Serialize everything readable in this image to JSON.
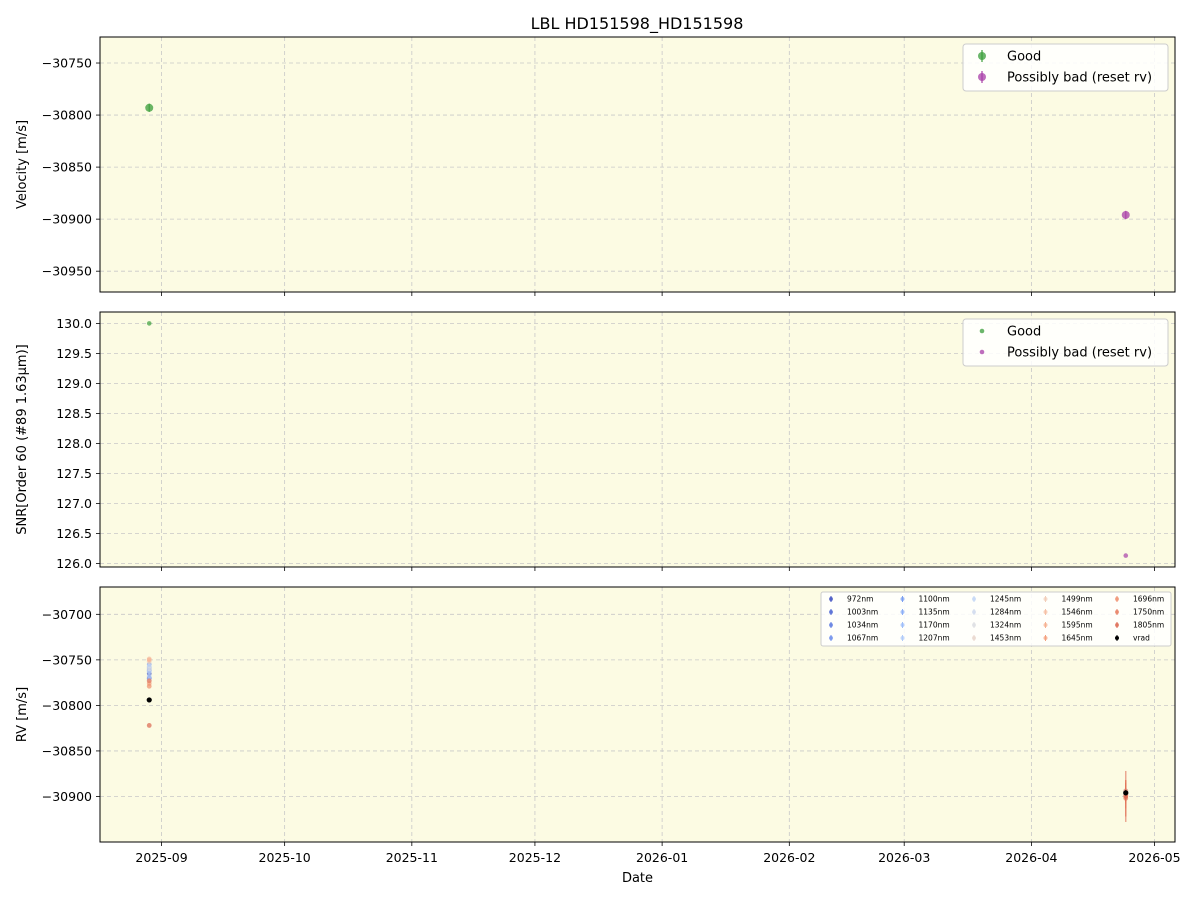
{
  "title": "LBL HD151598_HD151598",
  "colors": {
    "plot_bg": "#fcfbe3",
    "good": "#3a9e3a",
    "bad": "#a83ea8",
    "grid": "#c8c8c8",
    "vrad": "#000000"
  },
  "chart_data": [
    {
      "type": "scatter",
      "ylabel": "Velocity [m/s]",
      "xlabel": "",
      "ylim": [
        -30970,
        -30725
      ],
      "yticks": [
        -30750,
        -30800,
        -30850,
        -30900,
        -30950
      ],
      "grid": true,
      "legend_position": "top-right",
      "series": [
        {
          "name": "Good",
          "color": "#3a9e3a",
          "points": [
            {
              "x": "2025-08-29",
              "y": -30793,
              "err": 4
            }
          ]
        },
        {
          "name": "Possibly bad (reset rv)",
          "color": "#a83ea8",
          "points": [
            {
              "x": "2026-04-24",
              "y": -30896,
              "err": 4
            }
          ]
        }
      ]
    },
    {
      "type": "scatter",
      "ylabel": "SNR[Order 60 (#89 1.63μm)]",
      "xlabel": "",
      "ylim": [
        125.94,
        130.19
      ],
      "yticks": [
        126.0,
        126.5,
        127.0,
        127.5,
        128.0,
        128.5,
        129.0,
        129.5,
        130.0
      ],
      "grid": true,
      "legend_position": "top-right",
      "series": [
        {
          "name": "Good",
          "color": "#3a9e3a",
          "points": [
            {
              "x": "2025-08-29",
              "y": 130.0
            }
          ]
        },
        {
          "name": "Possibly bad (reset rv)",
          "color": "#a83ea8",
          "points": [
            {
              "x": "2026-04-24",
              "y": 126.13
            }
          ]
        }
      ]
    },
    {
      "type": "scatter",
      "ylabel": "RV [m/s]",
      "xlabel": "Date",
      "ylim": [
        -30950,
        -30670
      ],
      "yticks": [
        -30700,
        -30750,
        -30800,
        -30850,
        -30900
      ],
      "grid": true,
      "legend_position": "top-right",
      "series": [
        {
          "name": "972nm",
          "color": "#3b4cc0",
          "points": [
            {
              "x": "2025-08-29",
              "y": -30765
            },
            {
              "x": "2026-04-24",
              "y": -30896,
              "err": 8
            }
          ]
        },
        {
          "name": "1003nm",
          "color": "#4a63d3",
          "points": [
            {
              "x": "2025-08-29",
              "y": -30770
            },
            {
              "x": "2026-04-24",
              "y": -30897,
              "err": 8
            }
          ]
        },
        {
          "name": "1034nm",
          "color": "#5a78e0",
          "points": [
            {
              "x": "2025-08-29",
              "y": -30760
            },
            {
              "x": "2026-04-24",
              "y": -30895,
              "err": 8
            }
          ]
        },
        {
          "name": "1067nm",
          "color": "#6a8bec",
          "points": [
            {
              "x": "2025-08-29",
              "y": -30762
            },
            {
              "x": "2026-04-24",
              "y": -30898,
              "err": 8
            }
          ]
        },
        {
          "name": "1100nm",
          "color": "#7b9ff2",
          "points": [
            {
              "x": "2025-08-29",
              "y": -30755
            },
            {
              "x": "2026-04-24",
              "y": -30894,
              "err": 8
            }
          ]
        },
        {
          "name": "1135nm",
          "color": "#8caff7",
          "points": [
            {
              "x": "2025-08-29",
              "y": -30758
            },
            {
              "x": "2026-04-24",
              "y": -30896,
              "err": 8
            }
          ]
        },
        {
          "name": "1170nm",
          "color": "#9ebef9",
          "points": [
            {
              "x": "2025-08-29",
              "y": -30772
            },
            {
              "x": "2026-04-24",
              "y": -30895,
              "err": 8
            }
          ]
        },
        {
          "name": "1207nm",
          "color": "#b0cbf9",
          "points": [
            {
              "x": "2025-08-29",
              "y": -30768
            },
            {
              "x": "2026-04-24",
              "y": -30897,
              "err": 8
            }
          ]
        },
        {
          "name": "1245nm",
          "color": "#c0d4f5",
          "points": [
            {
              "x": "2025-08-29",
              "y": -30763
            },
            {
              "x": "2026-04-24",
              "y": -30896,
              "err": 8
            }
          ]
        },
        {
          "name": "1284nm",
          "color": "#cfdaee",
          "points": [
            {
              "x": "2025-08-29",
              "y": -30757
            },
            {
              "x": "2026-04-24",
              "y": -30895,
              "err": 8
            }
          ]
        },
        {
          "name": "1324nm",
          "color": "#dcdde2",
          "points": [
            {
              "x": "2025-08-29",
              "y": -30760
            },
            {
              "x": "2026-04-24",
              "y": -30897,
              "err": 8
            }
          ]
        },
        {
          "name": "1453nm",
          "color": "#e8d6cc",
          "points": [
            {
              "x": "2025-08-29",
              "y": -30774
            },
            {
              "x": "2026-04-24",
              "y": -30896,
              "err": 10
            }
          ]
        },
        {
          "name": "1499nm",
          "color": "#f1cdb9",
          "points": [
            {
              "x": "2025-08-29",
              "y": -30752
            },
            {
              "x": "2026-04-24",
              "y": -30895,
              "err": 10
            }
          ]
        },
        {
          "name": "1546nm",
          "color": "#f5c0a5",
          "points": [
            {
              "x": "2025-08-29",
              "y": -30749
            },
            {
              "x": "2026-04-24",
              "y": -30898,
              "err": 10
            }
          ]
        },
        {
          "name": "1595nm",
          "color": "#f6b191",
          "points": [
            {
              "x": "2025-08-29",
              "y": -30750
            },
            {
              "x": "2026-04-24",
              "y": -30896,
              "err": 10
            }
          ]
        },
        {
          "name": "1645nm",
          "color": "#f4a07e",
          "points": [
            {
              "x": "2025-08-29",
              "y": -30776
            },
            {
              "x": "2026-04-24",
              "y": -30894,
              "err": 12
            }
          ]
        },
        {
          "name": "1696nm",
          "color": "#ef8e6c",
          "points": [
            {
              "x": "2025-08-29",
              "y": -30779
            },
            {
              "x": "2026-04-24",
              "y": -30899,
              "err": 14
            }
          ]
        },
        {
          "name": "1750nm",
          "color": "#e77a5c",
          "points": [
            {
              "x": "2025-08-29",
              "y": -30773
            },
            {
              "x": "2026-04-24",
              "y": -30902,
              "err": 20
            }
          ]
        },
        {
          "name": "1805nm",
          "color": "#dc654e",
          "points": [
            {
              "x": "2025-08-29",
              "y": -30822
            },
            {
              "x": "2026-04-24",
              "y": -30900,
              "err": 28
            }
          ]
        },
        {
          "name": "vrad",
          "color": "#000000",
          "points": [
            {
              "x": "2025-08-29",
              "y": -30794
            },
            {
              "x": "2026-04-24",
              "y": -30896,
              "err": 3
            }
          ]
        }
      ]
    }
  ],
  "x_axis": {
    "range": [
      "2025-08-17",
      "2026-05-06"
    ],
    "ticks": [
      "2025-09",
      "2025-10",
      "2025-11",
      "2025-12",
      "2026-01",
      "2026-02",
      "2026-03",
      "2026-04",
      "2026-05"
    ]
  }
}
